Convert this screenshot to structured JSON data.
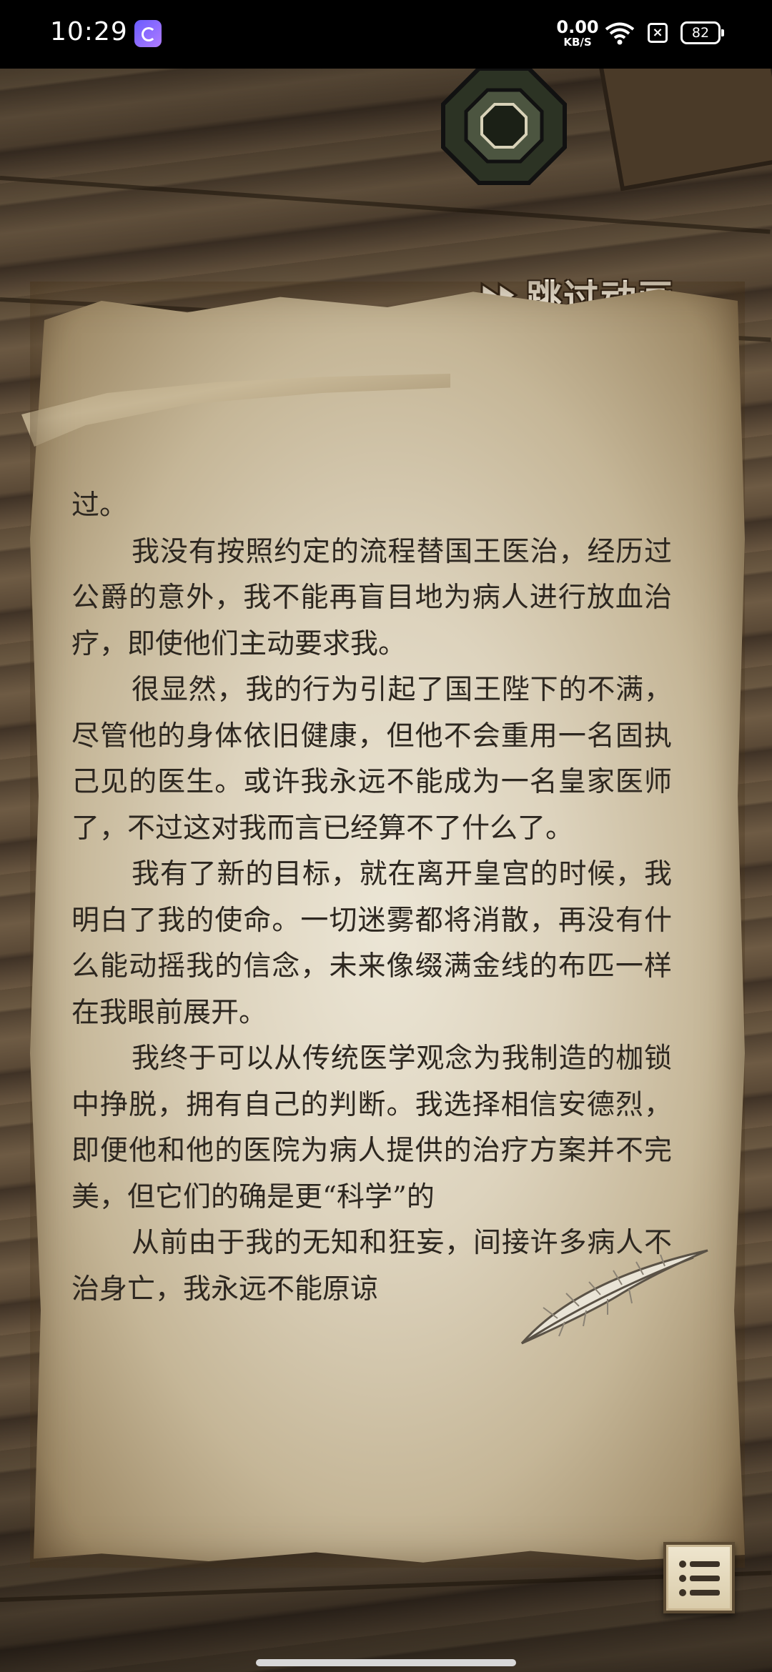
{
  "status_bar": {
    "time": "10:29",
    "net_speed_value": "0.00",
    "net_speed_unit": "KB/S",
    "battery": "82"
  },
  "game": {
    "skip_label": "跳过动画",
    "story_paragraphs": [
      "过。",
      "我没有按照约定的流程替国王医治，经历过公爵的意外，我不能再盲目地为病人进行放血治疗，即使他们主动要求我。",
      "很显然，我的行为引起了国王陛下的不满，尽管他的身体依旧健康，但他不会重用一名固执己见的医生。或许我永远不能成为一名皇家医师了，不过这对我而言已经算不了什么了。",
      "我有了新的目标，就在离开皇宫的时候，我明白了我的使命。一切迷雾都将消散，再没有什么能动摇我的信念，未来像缀满金线的布匹一样在我眼前展开。",
      "我终于可以从传统医学观念为我制造的枷锁中挣脱，拥有自己的判断。我选择相信安德烈，即便他和他的医院为病人提供的治疗方案并不完美，但它们的确是更“科学”的",
      "从前由于我的无知和狂妄，间接许多病人不治身亡，我永远不能原谅"
    ]
  }
}
